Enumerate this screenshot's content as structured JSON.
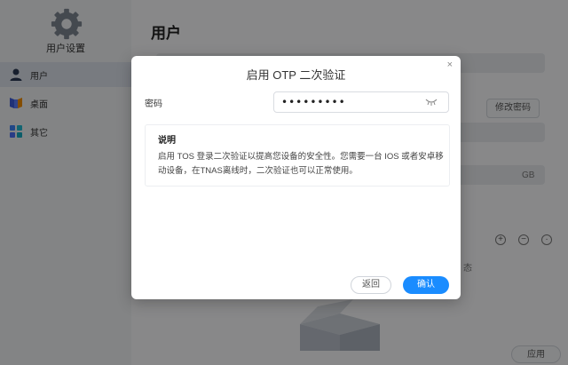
{
  "app": {
    "title": "用户设置"
  },
  "sidebar": {
    "items": [
      {
        "label": "用户",
        "icon": "user-icon"
      },
      {
        "label": "桌面",
        "icon": "desktop-icon"
      },
      {
        "label": "其它",
        "icon": "apps-icon"
      }
    ]
  },
  "main": {
    "title": "用户",
    "change_password_label": "修改密码",
    "quota_unit": "GB",
    "table_header_status": "态",
    "apply_label": "应用"
  },
  "dialog": {
    "title": "启用 OTP 二次验证",
    "close_label": "×",
    "password_label": "密码",
    "password_value": "•••••••••",
    "note_title": "说明",
    "note_text": "启用 TOS 登录二次验证以提高您设备的安全性。您需要一台 IOS 或者安卓移动设备，在TNAS离线时，二次验证也可以正常使用。",
    "back_label": "返回",
    "confirm_label": "确认"
  },
  "colors": {
    "accent": "#1a8cff"
  }
}
